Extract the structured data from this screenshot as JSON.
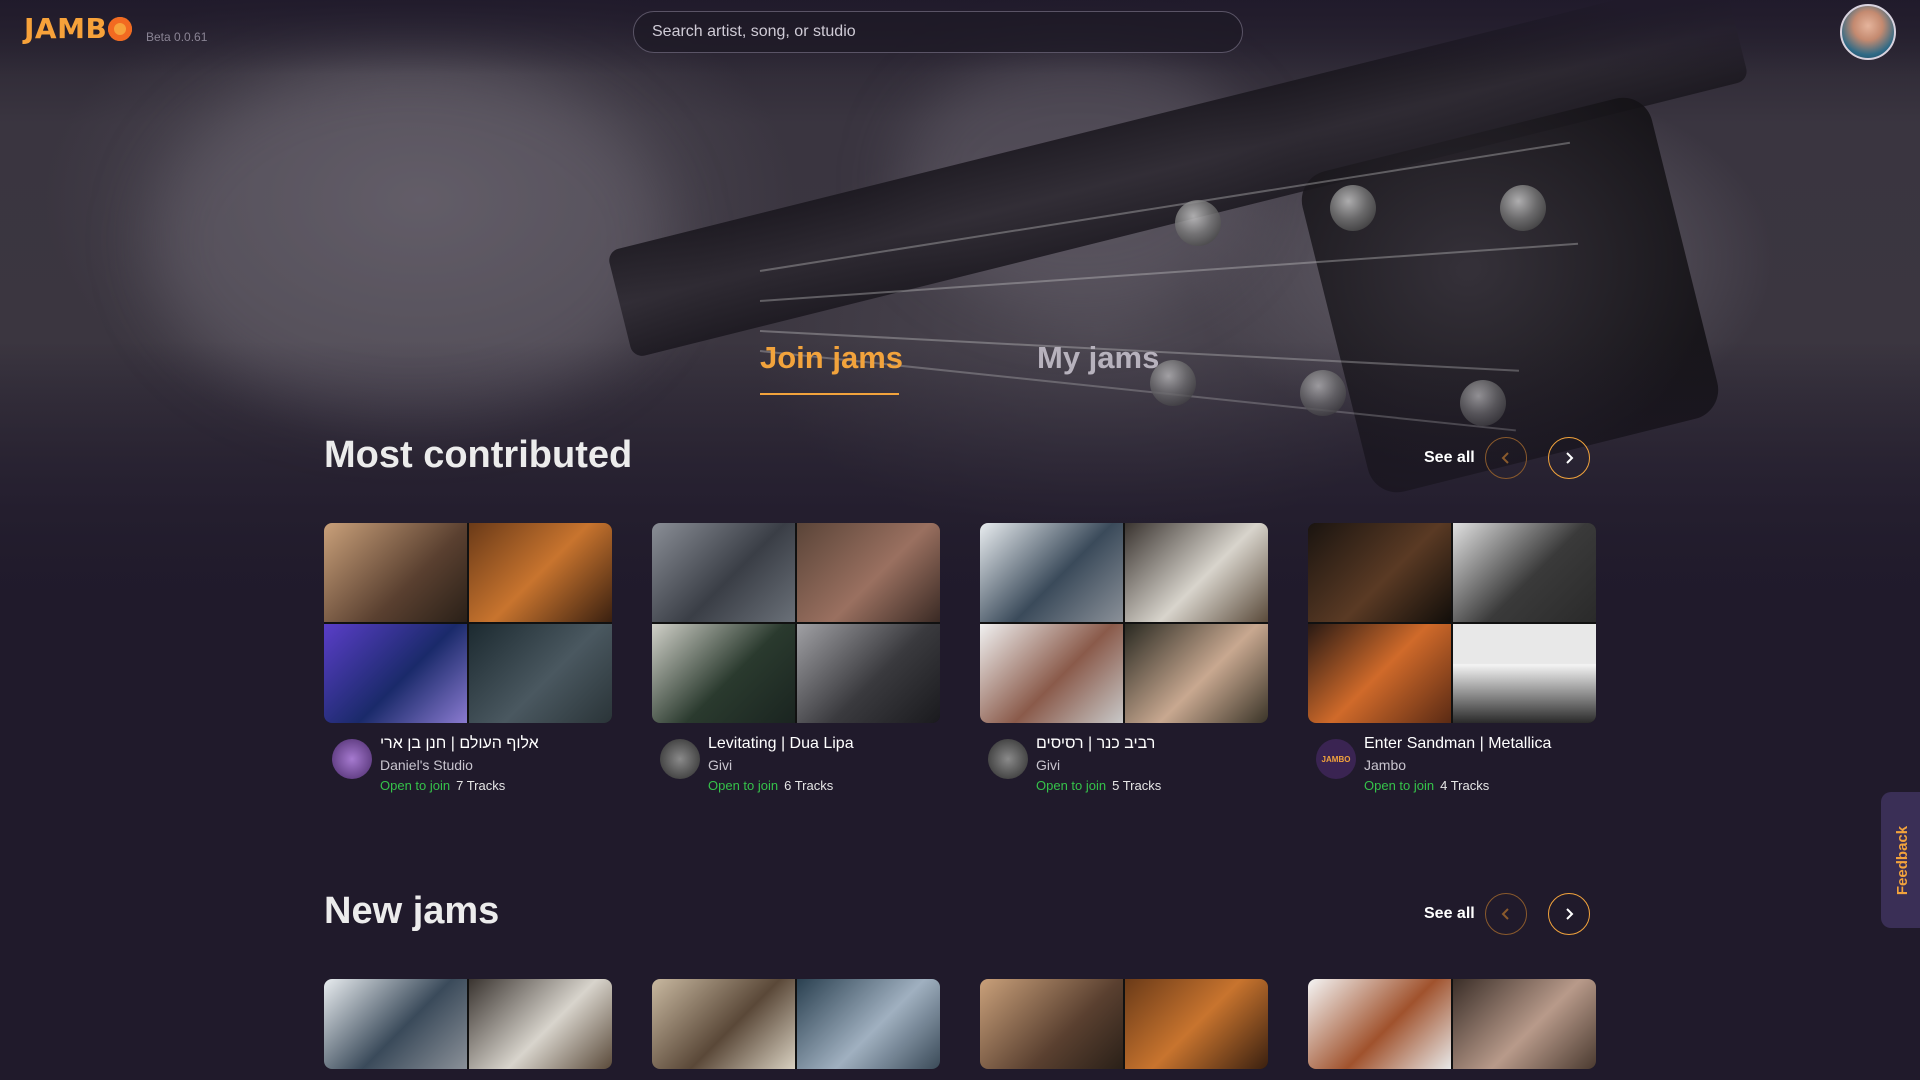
{
  "app": {
    "logo_text": "JAMB",
    "version": "Beta 0.0.61"
  },
  "search": {
    "placeholder": "Search artist, song, or studio"
  },
  "tabs": [
    {
      "label": "Join jams",
      "active": true
    },
    {
      "label": "My jams",
      "active": false
    }
  ],
  "colors": {
    "accent": "#f2a33c",
    "status_open": "#35c24a",
    "background": "#201a2b"
  },
  "sections": {
    "most_contributed": {
      "title": "Most contributed",
      "see_all": "See all",
      "cards": [
        {
          "title": "אלוף העולם | חנן בן ארי",
          "studio": "Daniel's Studio",
          "status": "Open to join",
          "tracks": "7 Tracks",
          "tiles": [
            "#8b6a4a",
            "#a5622d",
            "#3a3d9a",
            "#3c4048"
          ]
        },
        {
          "title": "Levitating | Dua Lipa",
          "studio": "Givi",
          "status": "Open to join",
          "tracks": "6 Tracks",
          "tiles": [
            "#5d6068",
            "#7a5a48",
            "#3b4a40",
            "#4a4a4e"
          ]
        },
        {
          "title": "רביב כנר | רסיסים",
          "studio": "Givi",
          "status": "Open to join",
          "tracks": "5 Tracks",
          "tiles": [
            "#5a6a7a",
            "#8a7a6a",
            "#6a6860",
            "#4a3e34"
          ]
        },
        {
          "title": "Enter Sandman | Metallica",
          "studio": "Jambo",
          "status": "Open to join",
          "tracks": "4 Tracks",
          "tiles": [
            "#3a2e26",
            "#4a4a4a",
            "#8a3a1e",
            "#bdbdbd"
          ]
        }
      ]
    },
    "new_jams": {
      "title": "New jams",
      "see_all": "See all",
      "cards": [
        {
          "tiles": [
            "#4a5a68",
            "#8a7a6a"
          ]
        },
        {
          "tiles": [
            "#6a5848",
            "#5a6a78"
          ]
        },
        {
          "tiles": [
            "#8b6a4a",
            "#a5622d"
          ]
        },
        {
          "tiles": [
            "#a8a8a8",
            "#6a5a50"
          ]
        }
      ]
    }
  },
  "card_avatar_labels": {
    "jambo": "JAMBO"
  },
  "feedback": {
    "label": "Feedback"
  }
}
